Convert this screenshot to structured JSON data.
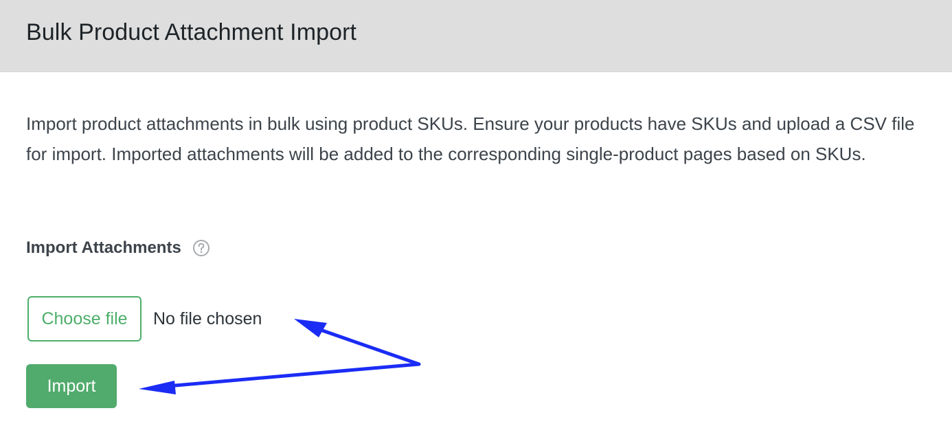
{
  "header": {
    "title": "Bulk Product Attachment Import"
  },
  "main": {
    "description": "Import product attachments in bulk using product SKUs. Ensure your products have SKUs and upload a CSV file for import. Imported attachments will be added to the corresponding single-product pages based on SKUs.",
    "field_label": "Import Attachments",
    "help_icon": "question-circle-icon",
    "file_input": {
      "button_label": "Choose file",
      "status": "No file chosen"
    },
    "import_button_label": "Import"
  },
  "annotation": {
    "arrow_color": "#1b2cf5",
    "arrow_icon": "blue-arrow-annotation"
  },
  "colors": {
    "header_bg": "#dedede",
    "accent_green": "#51ab6d",
    "outline_green": "#4cae6a"
  }
}
